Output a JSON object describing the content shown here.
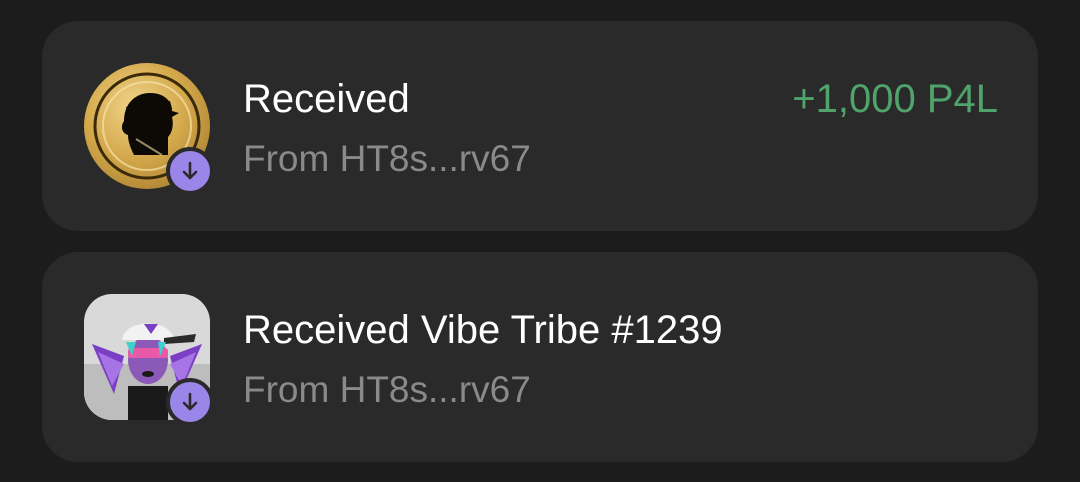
{
  "activity": {
    "items": [
      {
        "title": "Received",
        "subtitle": "From HT8s...rv67",
        "amount": "+1,000 P4L",
        "icon": "token-coin-icon",
        "badge_icon": "arrow-down-icon"
      },
      {
        "title": "Received Vibe Tribe #1239",
        "subtitle": "From HT8s...rv67",
        "icon": "nft-thumbnail",
        "badge_icon": "arrow-down-icon"
      }
    ]
  },
  "colors": {
    "background": "#1c1c1c",
    "card": "#2a2a2a",
    "amount_positive": "#4fa36b",
    "badge": "#9a86e8"
  }
}
